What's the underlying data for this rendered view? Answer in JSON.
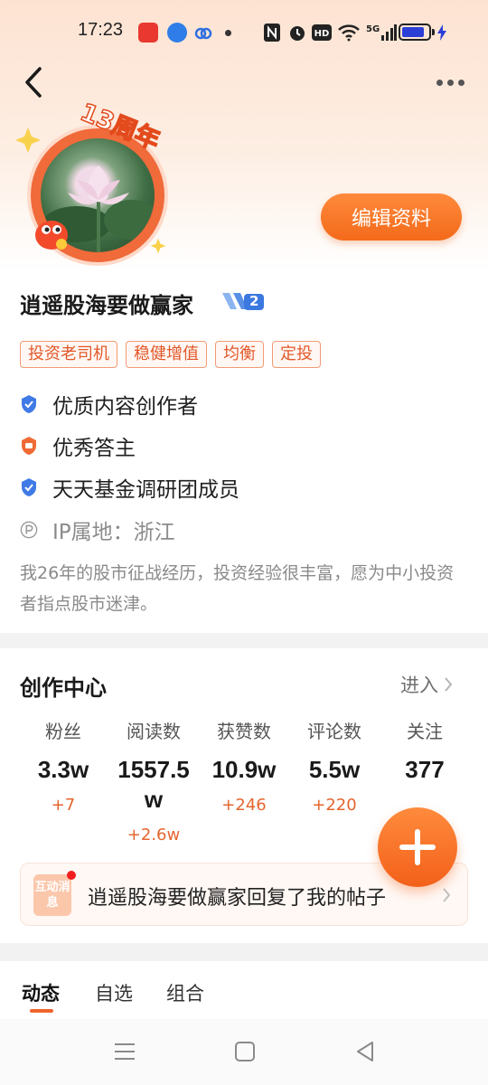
{
  "status_bar": {
    "time": "17:23",
    "network": "5G"
  },
  "badge": {
    "text": "13周年"
  },
  "header": {
    "edit_button": "编辑资料"
  },
  "profile": {
    "username": "逍遥股海要做赢家",
    "level": "2",
    "tags": [
      "投资老司机",
      "稳健增值",
      "均衡",
      "定投"
    ],
    "honors": [
      "优质内容创作者",
      "优秀答主",
      "天天基金调研团成员"
    ],
    "ip_location": "IP属地：浙江",
    "bio": "我26年的股市征战经历，投资经验很丰富，愿为中小投资者指点股市迷津。"
  },
  "creation_center": {
    "title": "创作中心",
    "enter_label": "进入",
    "stats": [
      {
        "label": "粉丝",
        "value": "3.3w",
        "delta": "+7"
      },
      {
        "label": "阅读数",
        "value": "1557.5w",
        "delta": "+2.6w"
      },
      {
        "label": "获赞数",
        "value": "10.9w",
        "delta": "+246"
      },
      {
        "label": "评论数",
        "value": "5.5w",
        "delta": "+220"
      },
      {
        "label": "关注",
        "value": "377",
        "delta": ""
      }
    ],
    "message": {
      "icon_text": "互动消息",
      "text": "逍遥股海要做赢家回复了我的帖子"
    }
  },
  "tabs": [
    "动态",
    "自选",
    "组合"
  ],
  "colors": {
    "accent": "#f36a1a",
    "tag_text": "#e2582a",
    "verified_blue": "#2f6fe0"
  }
}
